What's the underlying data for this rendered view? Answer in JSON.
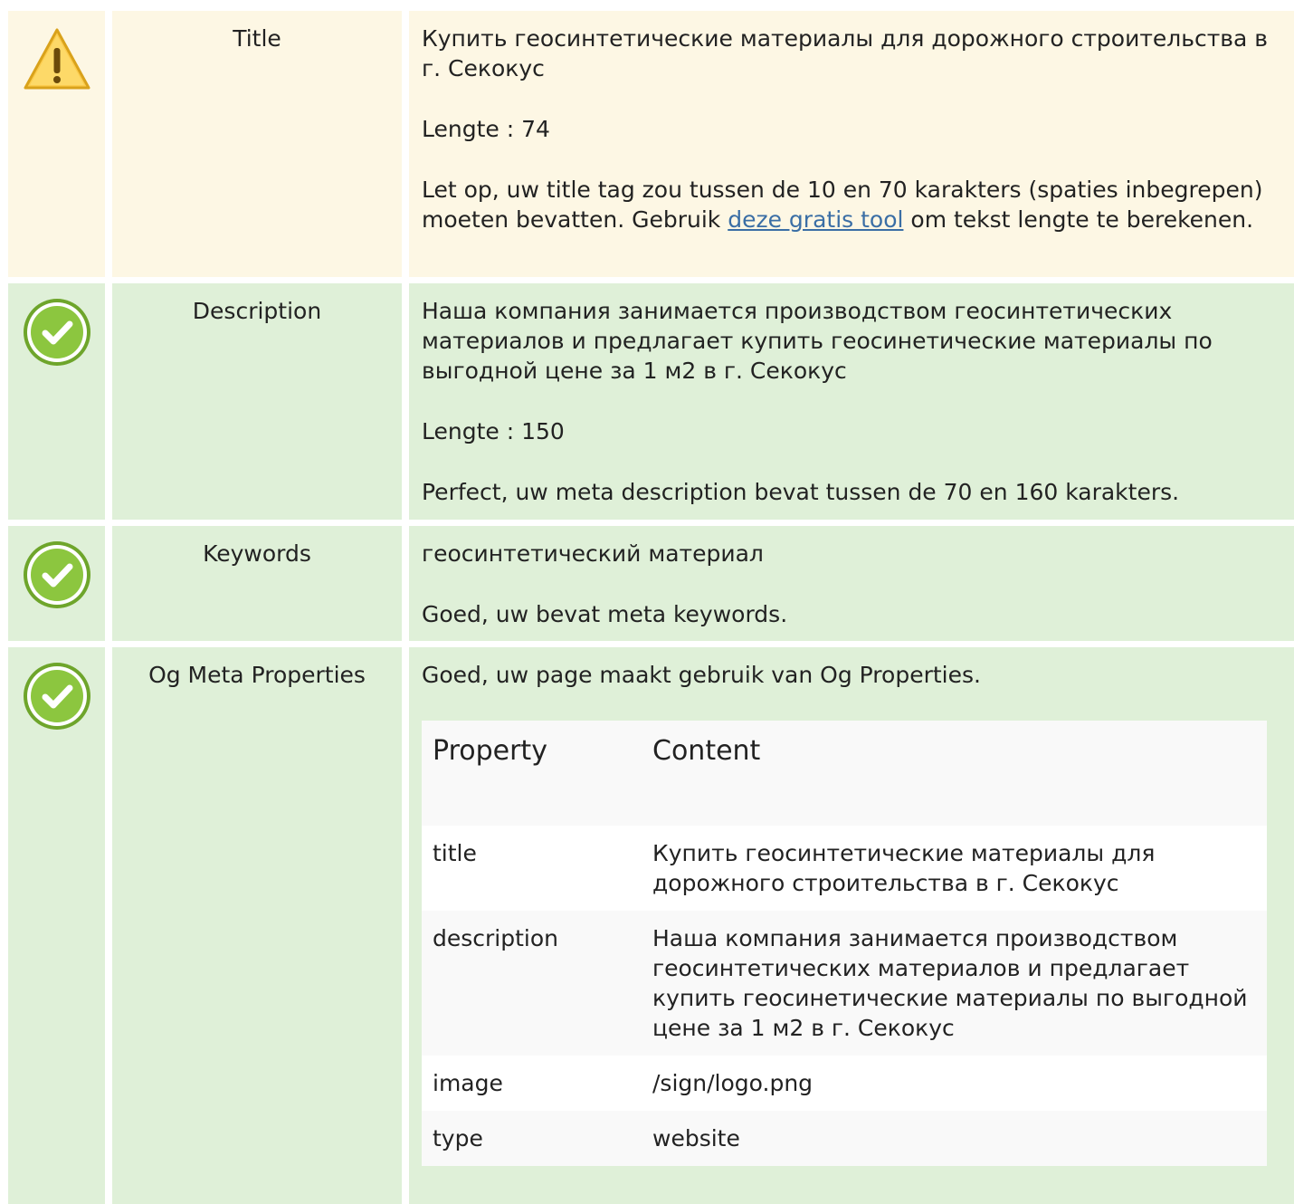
{
  "rows": [
    {
      "status": "warning",
      "label": "Title",
      "value": "Купить геосинтетические материалы для дорожного строительства в г. Секокус",
      "length_text": "Lengte : 74",
      "note_before": "Let op, uw title tag zou tussen de 10 en 70 karakters (spaties inbegrepen) moeten bevatten. Gebruik ",
      "note_link": "deze gratis tool",
      "note_after": " om tekst lengte te berekenen."
    },
    {
      "status": "ok",
      "label": "Description",
      "value": "Наша компания занимается производством геосинтетических материалов и предлагает купить геосинетические материалы по выгодной цене за 1 м2 в г. Секокус",
      "length_text": "Lengte : 150",
      "note": "Perfect, uw meta description bevat tussen de 70 en 160 karakters."
    },
    {
      "status": "ok",
      "label": "Keywords",
      "value": "геосинтетический материал",
      "note": "Goed, uw bevat meta keywords."
    },
    {
      "status": "ok",
      "label": "Og Meta Properties",
      "note": "Goed, uw page maakt gebruik van Og Properties.",
      "table": {
        "headers": [
          "Property",
          "Content"
        ],
        "rows": [
          [
            "title",
            "Купить геосинтетические материалы для дорожного строительства в г. Секокус"
          ],
          [
            "description",
            "Наша компания занимается производством геосинтетических материалов и предлагает купить геосинетические материалы по выгодной цене за 1 м2 в г. Секокус"
          ],
          [
            "image",
            "/sign/logo.png"
          ],
          [
            "type",
            "website"
          ]
        ]
      }
    }
  ],
  "icons": {
    "warning": "warning-triangle-icon",
    "ok": "check-circle-icon"
  },
  "colors": {
    "warning_bg": "#fdf7e4",
    "ok_bg": "#dff0d8",
    "link": "#3a6ea5",
    "warning_fill": "#fccc4d",
    "ok_fill": "#8cc63f"
  }
}
